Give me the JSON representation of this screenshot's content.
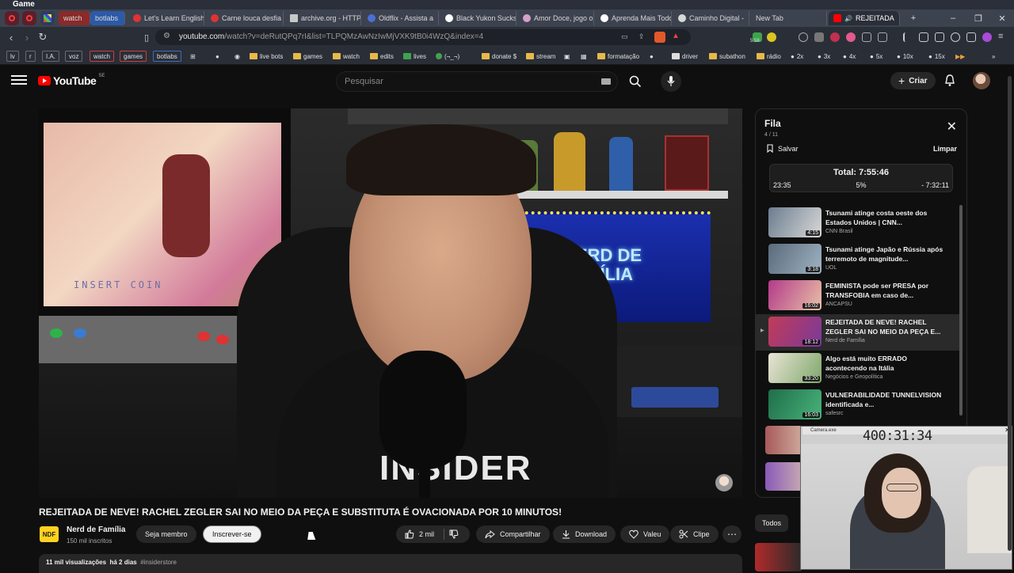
{
  "os": {
    "title": "Game"
  },
  "tabs": [
    {
      "label": "watch",
      "color": "#c94040"
    },
    {
      "label": "botlabs",
      "color": "#3c6fbf"
    },
    {
      "label": "Let's Learn English",
      "color": "#e03333"
    },
    {
      "label": "Carne louca desfia",
      "color": "#e03333"
    },
    {
      "label": "archive.org - HTTP",
      "color": "#c8c8c8"
    },
    {
      "label": "Oldflix - Assista a",
      "color": "#4b6fd6"
    },
    {
      "label": "Black Yukon Sucks",
      "color": "#ffffff"
    },
    {
      "label": "Amor Doce, jogo o",
      "color": "#d6a0c8"
    },
    {
      "label": "Aprenda Mais Todo",
      "color": "#ffffff"
    },
    {
      "label": "Caminho Digital -",
      "color": "#d8d8d8"
    },
    {
      "label": "New Tab",
      "color": "#888888"
    },
    {
      "label": "REJEITADA",
      "color": "#ff0000"
    }
  ],
  "address": {
    "domain": "youtube.com",
    "path": "/watch?v=deRutQPq7rI&list=TLPQMzAwNzIwMjVXK9tB0i4WzQ&index=4",
    "badge": "5.58"
  },
  "bookmarks": {
    "boxes": [
      "lv",
      "r",
      "I.A.",
      "voz",
      "watch",
      "games",
      "botlabs"
    ],
    "items": [
      "live bots",
      "games",
      "watch",
      "edits",
      "lives",
      "(¬_¬)",
      "donate $",
      "stream",
      "formatação",
      "driver",
      "subathon",
      "rádio",
      "2x",
      "3x",
      "4x",
      "5x",
      "10x",
      "15x"
    ]
  },
  "header": {
    "logo_text": "YouTube",
    "logo_country": "SE",
    "search_placeholder": "Pesquisar",
    "create_label": "Criar"
  },
  "video": {
    "title": "REJEITADA DE NEVE! RACHEL ZEGLER SAI NO MEIO DA PEÇA E SUBSTITUTA É OVACIONADA POR 10 MINUTOS!",
    "scene_text_arcade": "INSERT COIN",
    "scene_text_neon": "NERD DE FAMÍLIA",
    "channel": {
      "avatar_text": "NDF",
      "name": "Nerd de Família",
      "subscribers": "150 mil inscritos"
    },
    "member_label": "Seja membro",
    "subscribe_label": "Inscrever-se",
    "likes": "2 mil",
    "share_label": "Compartilhar",
    "download_label": "Download",
    "thanks_label": "Valeu",
    "clip_label": "Clipe",
    "views": "11 mil visualizações",
    "age": "há 2 dias",
    "hashtag": "#insiderstore"
  },
  "queue": {
    "title": "Fila",
    "position": "4 / 11",
    "save_label": "Salvar",
    "clear_label": "Limpar",
    "total": "Total: 7:55:46",
    "elapsed": "23:35",
    "percent": "5%",
    "remaining": "- 7:32:11",
    "items": [
      {
        "title": "Tsunami atinge costa oeste dos Estados Unidos | CNN...",
        "channel": "CNN Brasil",
        "duration": "4:15",
        "c1": "#6b7d8f",
        "c2": "#d9d9d9",
        "active": false
      },
      {
        "title": "Tsunami atinge Japão e Rússia após terremoto de magnitude...",
        "channel": "UOL",
        "duration": "3:18",
        "c1": "#5a6b7a",
        "c2": "#9fb3c4",
        "active": false
      },
      {
        "title": "FEMINISTA pode ser PRESA por TRANSFOBIA em caso de...",
        "channel": "ANCAPSU",
        "duration": "16:02",
        "c1": "#b33a8a",
        "c2": "#e9c1a6",
        "active": false
      },
      {
        "title": "REJEITADA DE NEVE! RACHEL ZEGLER SAI NO MEIO DA PEÇA E...",
        "channel": "Nerd de Família",
        "duration": "18:12",
        "c1": "#c23b57",
        "c2": "#7a3a9a",
        "active": true
      },
      {
        "title": "Algo está muito ERRADO acontecendo na Itália",
        "channel": "Negócios e Geopolítica",
        "duration": "33:20",
        "c1": "#e9e4d6",
        "c2": "#7fa86a",
        "active": false
      },
      {
        "title": "VULNERABILIDADE TUNNELVISION identificada e...",
        "channel": "safesrc",
        "duration": "16:03",
        "c1": "#1f6e4a",
        "c2": "#48b37a",
        "active": false
      }
    ]
  },
  "sidebar": {
    "chip_all": "Todos"
  },
  "webcam": {
    "title": "Camera.exe",
    "timer": "400:31:34"
  }
}
